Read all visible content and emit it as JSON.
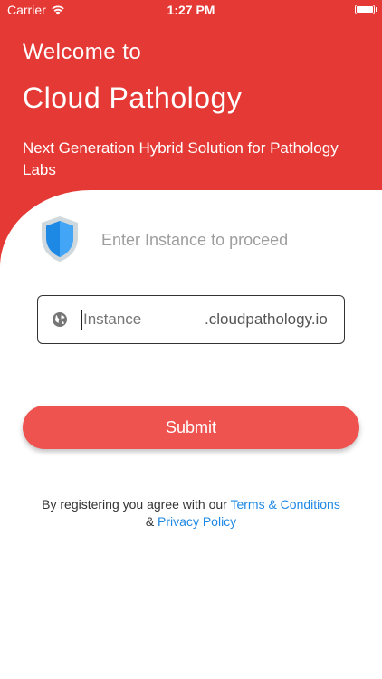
{
  "status_bar": {
    "carrier": "Carrier",
    "time": "1:27 PM",
    "wifi_icon": "wifi-icon",
    "battery_icon": "battery-icon"
  },
  "header": {
    "welcome": "Welcome to",
    "title": "Cloud Pathology",
    "tagline": "Next Generation Hybrid Solution for Pathology Labs"
  },
  "instance": {
    "shield_icon": "shield-icon",
    "prompt": "Enter Instance to proceed",
    "globe_icon": "globe-icon",
    "value": "",
    "placeholder": "Instance",
    "suffix": ".cloudpathology.io"
  },
  "submit": {
    "label": "Submit"
  },
  "legal": {
    "prefix": "By registering you agree with our ",
    "terms_link": "Terms & Conditions",
    "joiner": "& ",
    "privacy_link": "Privacy Policy"
  },
  "colors": {
    "brand_red": "#e53935",
    "button_red": "#ef5350",
    "link_blue": "#1e88e5",
    "shield_blue": "#1e88e5",
    "shield_border": "#cfd8dc"
  }
}
